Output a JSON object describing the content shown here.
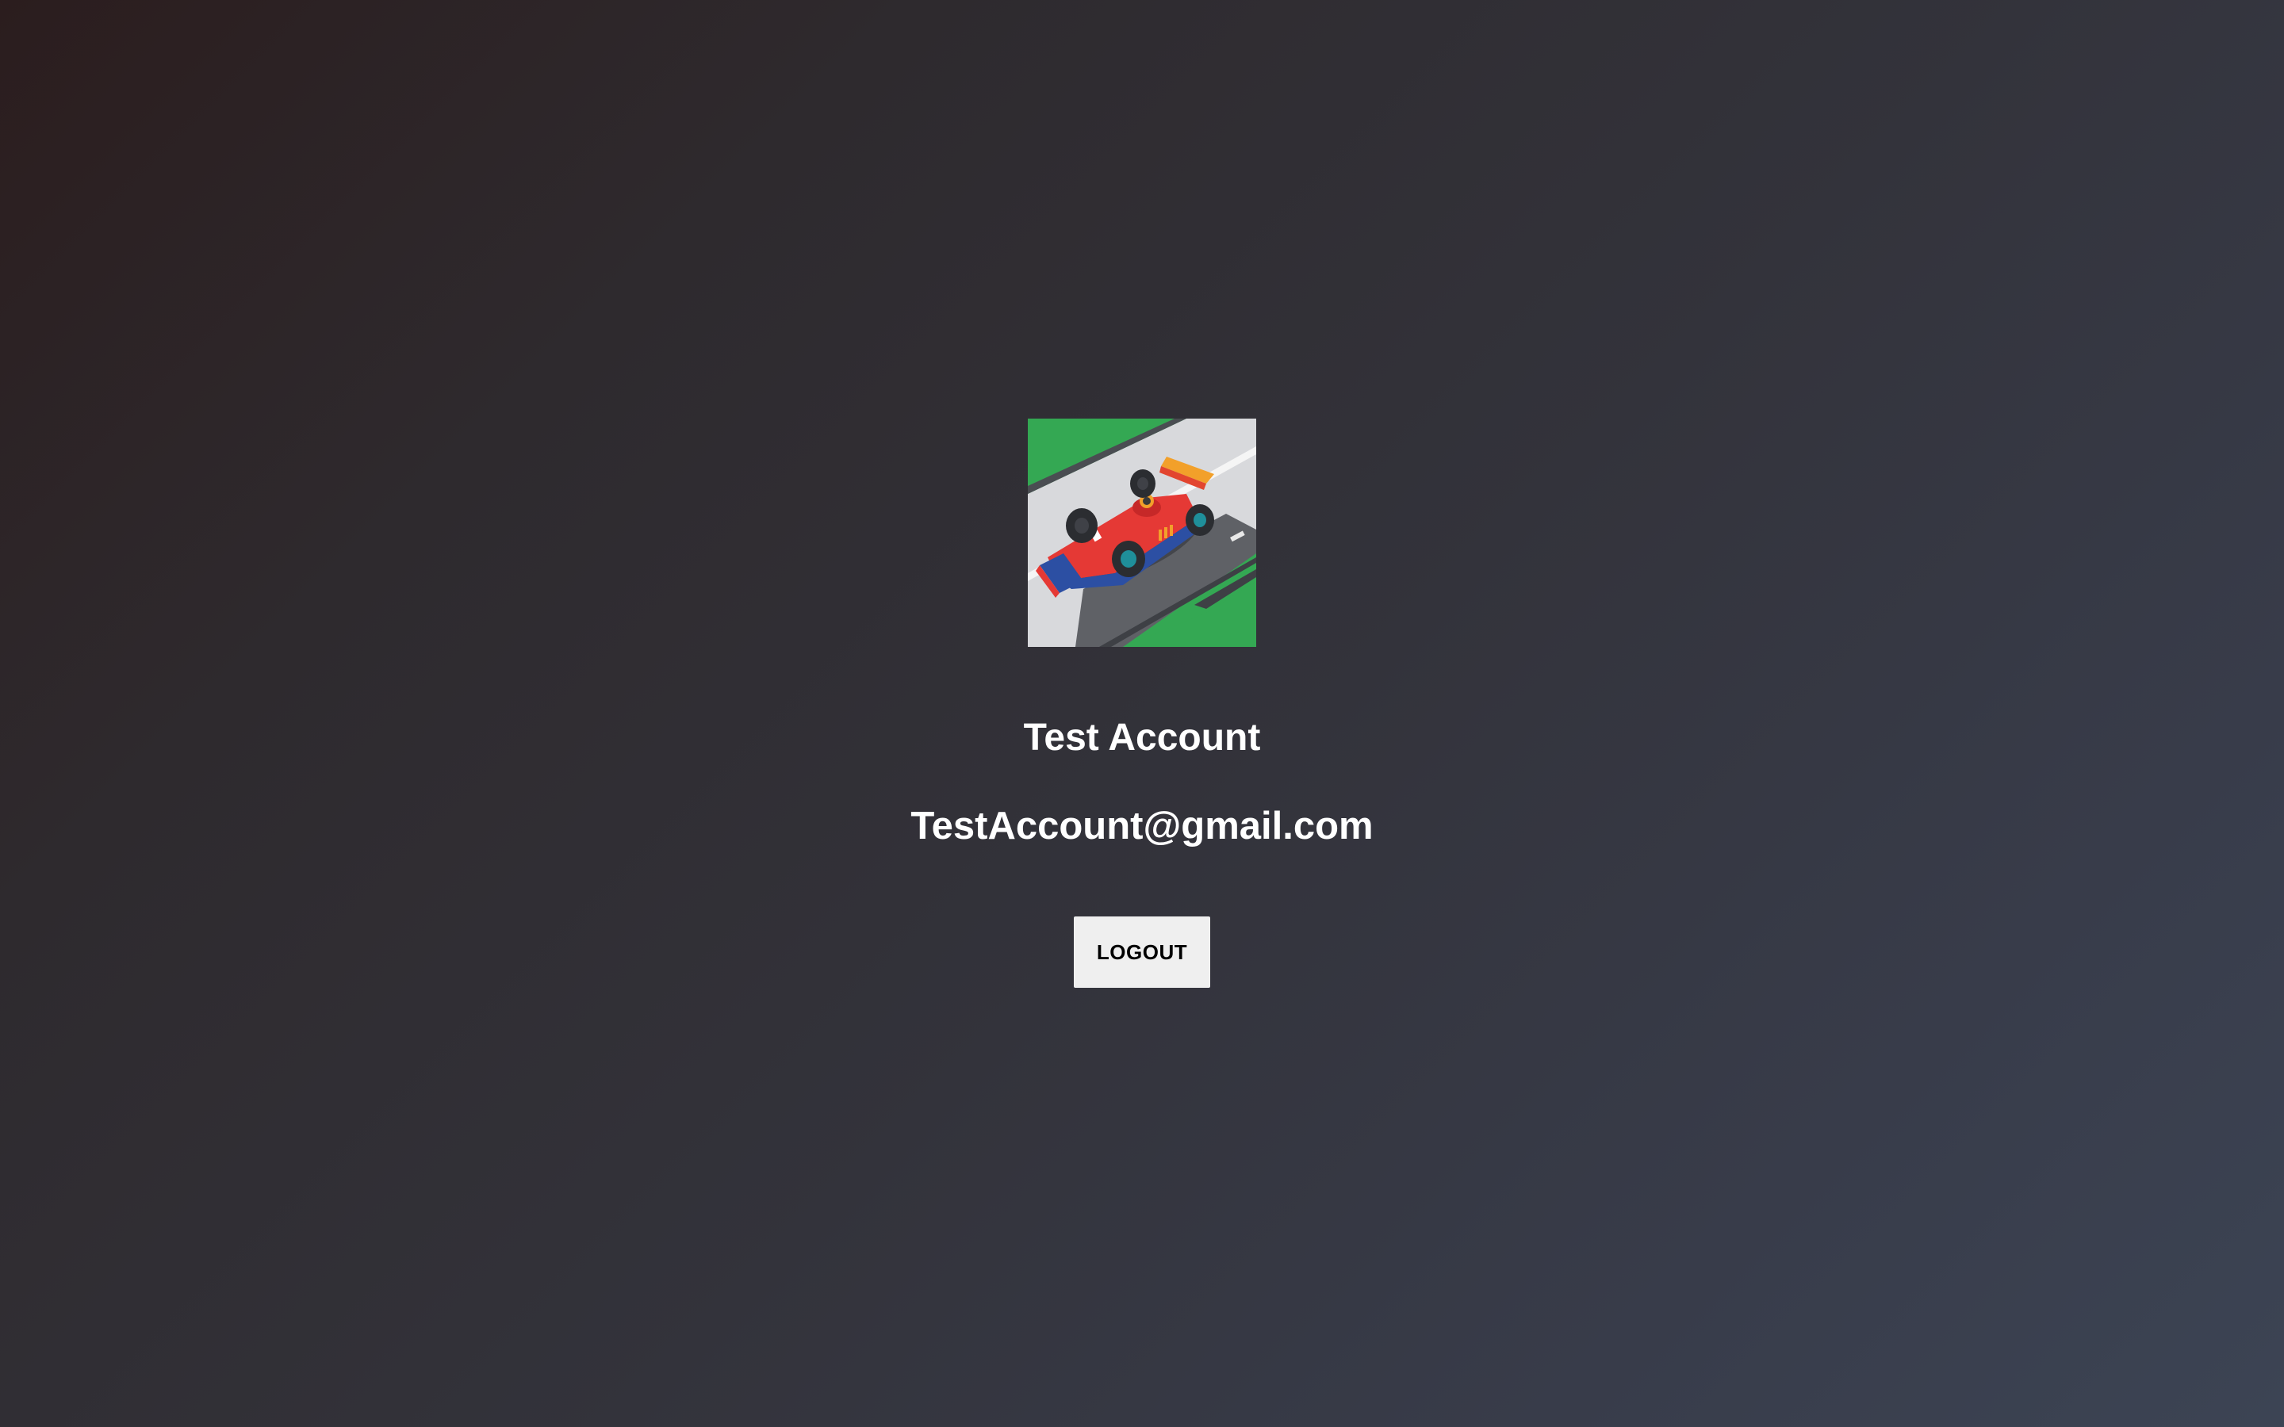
{
  "profile": {
    "avatar_icon": "race-car-avatar-icon",
    "name": "Test Account",
    "email": "TestAccount@gmail.com",
    "logout_label": "LOGOUT"
  },
  "colors": {
    "background_start": "#2b1d1e",
    "background_end": "#3c4454",
    "button_background": "#efefef",
    "button_text": "#000000",
    "text": "#ffffff"
  }
}
